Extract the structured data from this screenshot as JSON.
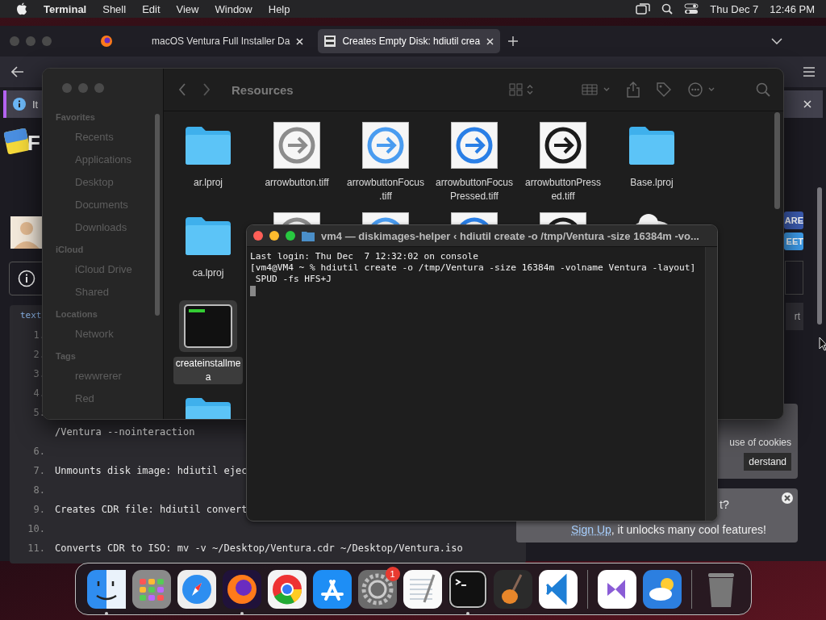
{
  "menubar": {
    "app": "Terminal",
    "menus": [
      "Shell",
      "Edit",
      "View",
      "Window",
      "Help"
    ],
    "date": "Thu Dec 7",
    "time": "12:46 PM"
  },
  "browser": {
    "tabs": [
      {
        "title": "macOS Ventura Full Installer Da",
        "selected": false
      },
      {
        "title": "Creates Empty Disk: hdiutil crea",
        "selected": true
      }
    ],
    "info_bar": {
      "text": "It"
    },
    "page_title": "F",
    "code": {
      "tab": "text",
      "lines": [
        {
          "number": "1."
        },
        {
          "number": "2."
        },
        {
          "number": "3."
        },
        {
          "number": "4."
        },
        {
          "number": "5."
        },
        {
          "text": "/Ventura --nointeraction"
        },
        {
          "number": "6."
        },
        {
          "number": "7.",
          "text": "Unmounts disk image: hdiutil ejec"
        },
        {
          "number": "8."
        },
        {
          "number": "9.",
          "text": "Creates CDR file: hdiutil convert"
        },
        {
          "number": "10."
        },
        {
          "number": "11.",
          "text": "Converts CDR to ISO: mv -v ~/Desktop/Ventura.cdr ~/Desktop/Ventura.iso"
        }
      ]
    },
    "share_buttons": [
      "ARE",
      "EET"
    ],
    "side_tab": "rt",
    "cookie": {
      "text": "use of cookies",
      "button": "derstand"
    },
    "signup": {
      "question": "t?",
      "link": "Sign Up",
      "text": ", it unlocks many cool features!"
    }
  },
  "finder": {
    "title": "Resources",
    "sidebar": [
      {
        "heading": "Favorites",
        "items": [
          "Recents",
          "Applications",
          "Desktop",
          "Documents",
          "Downloads"
        ]
      },
      {
        "heading": "iCloud",
        "items": [
          "iCloud Drive",
          "Shared"
        ]
      },
      {
        "heading": "Locations",
        "items": [
          "Network"
        ]
      },
      {
        "heading": "Tags",
        "items": [
          "rewwrerer",
          "Red"
        ]
      }
    ],
    "file_rows": [
      [
        {
          "kind": "folder",
          "lines": [
            "ar.lproj"
          ],
          "selected": false
        },
        {
          "kind": "arrow",
          "color": "#8c8c8c",
          "lines": [
            "arrowbutton.tiff"
          ],
          "selected": false
        },
        {
          "kind": "arrow",
          "color": "#4a9cf0",
          "lines": [
            "arrowbuttonFocus",
            ".tiff"
          ],
          "selected": false
        },
        {
          "kind": "arrow",
          "color": "#2a7fe6",
          "lines": [
            "arrowbuttonFocus",
            "Pressed.tiff"
          ],
          "selected": false
        },
        {
          "kind": "arrow",
          "color": "#1c1c1c",
          "lines": [
            "arrowbuttonPress",
            "ed.tiff"
          ],
          "selected": false
        },
        {
          "kind": "folder",
          "lines": [
            "Base.lproj"
          ],
          "selected": false
        }
      ],
      [
        {
          "kind": "folder",
          "lines": [
            "ca.lproj"
          ],
          "selected": false
        },
        {
          "kind": "arrow",
          "color": "#8c8c8c"
        },
        {
          "kind": "arrow",
          "color": "#4a9cf0"
        },
        {
          "kind": "arrow",
          "color": "#2a7fe6"
        },
        {
          "kind": "arrow",
          "color": "#1c1c1c"
        },
        {
          "kind": "cloud"
        }
      ],
      [
        {
          "kind": "exec",
          "lines": [
            "createinstallme",
            "a"
          ],
          "selected": true
        }
      ],
      [
        {
          "kind": "folder",
          "selected": false
        }
      ]
    ]
  },
  "terminal": {
    "title": "vm4 — diskimages-helper ‹ hdiutil create -o /tmp/Ventura -size 16384m -vo...",
    "lines": [
      "Last login: Thu Dec  7 12:32:02 on console",
      "[vm4@VM4 ~ % hdiutil create -o /tmp/Ventura -size 16384m -volname Ventura -layout]",
      " SPUD -fs HFS+J"
    ]
  },
  "dock": {
    "groups": [
      [
        {
          "kind": "finder",
          "running": true
        },
        {
          "kind": "launchpad",
          "running": false
        },
        {
          "kind": "safari",
          "running": false
        },
        {
          "kind": "firefox",
          "running": true
        },
        {
          "kind": "chrome",
          "running": false
        },
        {
          "kind": "appstore",
          "running": false
        },
        {
          "kind": "settings",
          "running": false,
          "badge": "1"
        },
        {
          "kind": "textedit",
          "running": false
        },
        {
          "kind": "terminal",
          "running": true
        },
        {
          "kind": "guitar",
          "running": false
        },
        {
          "kind": "vscode",
          "running": false
        }
      ],
      [
        {
          "kind": "visualstudio",
          "running": false
        },
        {
          "kind": "weather",
          "running": false
        }
      ],
      [
        {
          "kind": "trash",
          "running": false
        }
      ]
    ]
  }
}
